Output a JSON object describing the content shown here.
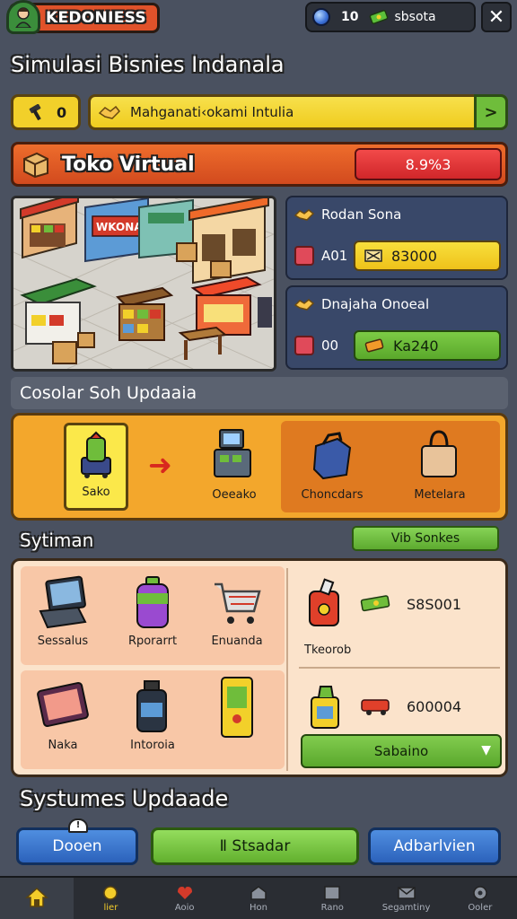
{
  "header": {
    "player_name": "KEDONIESS",
    "gem_count": "10",
    "coin_label": "sbsota",
    "close_symbol": "✕"
  },
  "page_title": "Simulasi Bisnies Indanala",
  "mission": {
    "counter": "0",
    "text": "Mahganati‹okami Intulia",
    "arrow": ">"
  },
  "store": {
    "title": "Toko Virtual",
    "progress": "8.9%3"
  },
  "stats": {
    "top_label": "Rodan Sona",
    "top_row_label": "A01",
    "top_value": "83000",
    "bottom_label": "Dnajaha Onoeal",
    "bottom_row_label": "00",
    "bottom_value": "Ka240"
  },
  "upgrade_section": {
    "title": "Cosolar Soh Updaaia",
    "steps": [
      "Sako",
      "Oeeako",
      "Choncdars",
      "Metelara"
    ]
  },
  "systems": {
    "title": "Sytiman",
    "web_button": "Vib Sonkes",
    "items_top": [
      "Sessalus",
      "Rporarrt",
      "Enuanda"
    ],
    "items_bottom": [
      "Naka",
      "Intoroia"
    ],
    "right_item_label": "Tkeorob",
    "right_value_1": "S8S001",
    "right_value_2": "600004",
    "dropdown_value": "Sabaino",
    "dropdown_chevron": "▼"
  },
  "updates": {
    "title": "Systumes Updaade",
    "bell_mark": "!",
    "open_button": "Dooen",
    "standard_button": "Ⅱ Stsadar",
    "advanced_button": "Adbarlvien"
  },
  "nav": {
    "items": [
      "",
      "lier",
      "Aoio",
      "Hon",
      "Rano",
      "Segamtiny",
      "Ooler"
    ]
  },
  "colors": {
    "background": "#4a5160",
    "accent_orange": "#e0522a",
    "accent_yellow": "#f2d02a",
    "accent_green": "#6fbd3b",
    "accent_blue": "#2c62bb"
  }
}
